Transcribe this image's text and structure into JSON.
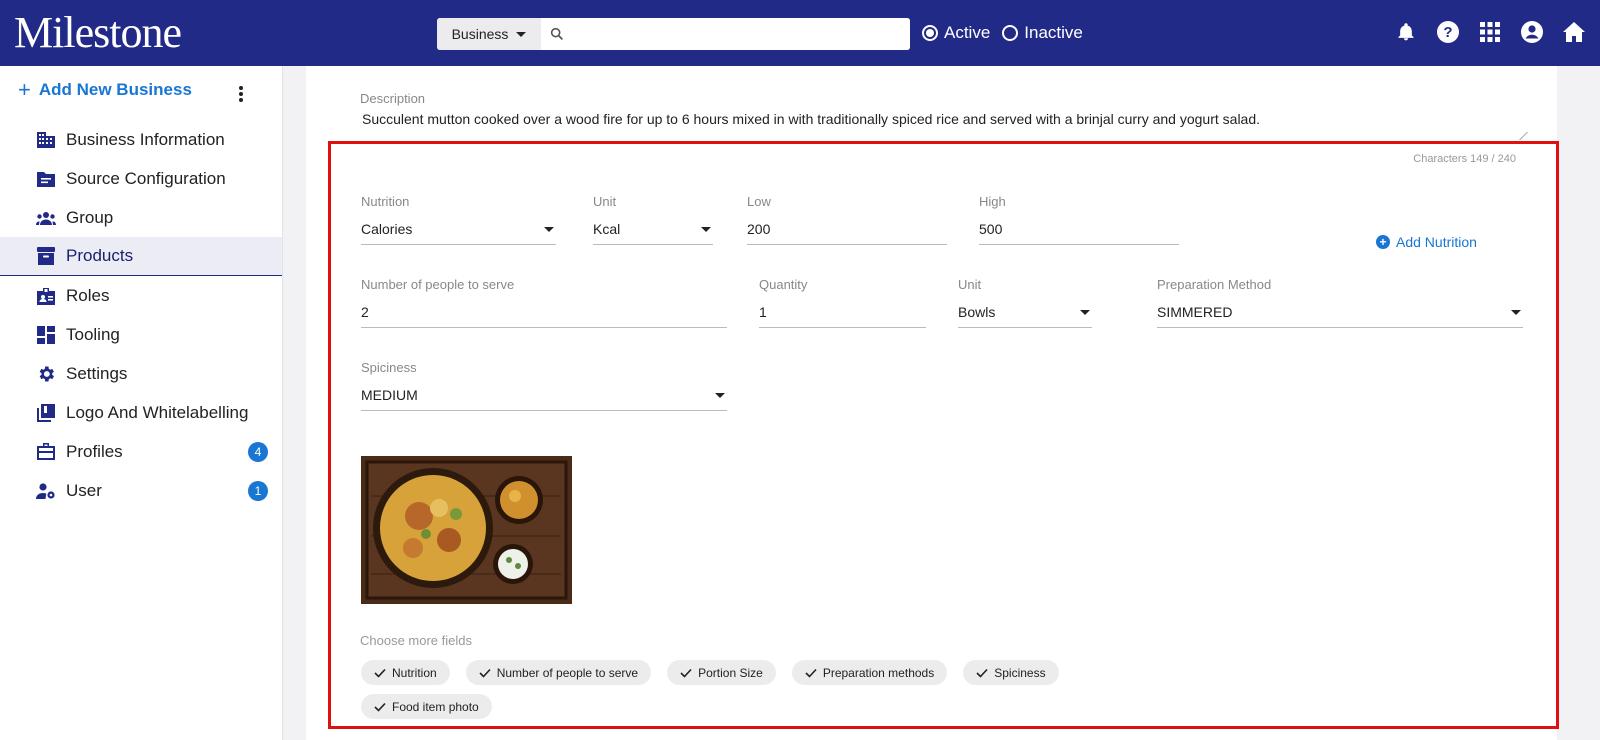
{
  "header": {
    "logo": "Milestone",
    "search_type": "Business",
    "search_placeholder": "",
    "radio_active": "Active",
    "radio_inactive": "Inactive"
  },
  "sidebar": {
    "add_label": "Add New Business",
    "items": [
      {
        "label": "Business Information",
        "icon": "building-icon"
      },
      {
        "label": "Source Configuration",
        "icon": "folder-icon"
      },
      {
        "label": "Group",
        "icon": "group-icon"
      },
      {
        "label": "Products",
        "icon": "archive-icon",
        "active": true
      },
      {
        "label": "Roles",
        "icon": "badge-icon"
      },
      {
        "label": "Tooling",
        "icon": "dashboard-icon"
      },
      {
        "label": "Settings",
        "icon": "gear-icon"
      },
      {
        "label": "Logo And Whitelabelling",
        "icon": "library-icon"
      },
      {
        "label": "Profiles",
        "icon": "briefcase-icon",
        "badge": "4"
      },
      {
        "label": "User",
        "icon": "user-gear-icon",
        "badge": "1"
      }
    ]
  },
  "form": {
    "description_label": "Description",
    "description": "Succulent mutton cooked over a wood fire for up to 6 hours mixed in with traditionally spiced rice and served with a brinjal curry and yogurt salad.",
    "char_count": "Characters 149 / 240",
    "nutrition": {
      "label": "Nutrition",
      "value": "Calories"
    },
    "nutrition_unit": {
      "label": "Unit",
      "value": "Kcal"
    },
    "low": {
      "label": "Low",
      "value": "200"
    },
    "high": {
      "label": "High",
      "value": "500"
    },
    "add_nutrition": "Add Nutrition",
    "people": {
      "label": "Number of people to serve",
      "value": "2"
    },
    "quantity": {
      "label": "Quantity",
      "value": "1"
    },
    "quantity_unit": {
      "label": "Unit",
      "value": "Bowls"
    },
    "prep": {
      "label": "Preparation Method",
      "value": "SIMMERED"
    },
    "spiciness": {
      "label": "Spiciness",
      "value": "MEDIUM"
    },
    "more_label": "Choose more fields",
    "chips": [
      "Nutrition",
      "Number of people to serve",
      "Portion Size",
      "Preparation methods",
      "Spiciness",
      "Food item photo"
    ]
  },
  "colors": {
    "header_bg": "#222a87",
    "accent": "#1976d2",
    "highlight": "#e01010"
  }
}
